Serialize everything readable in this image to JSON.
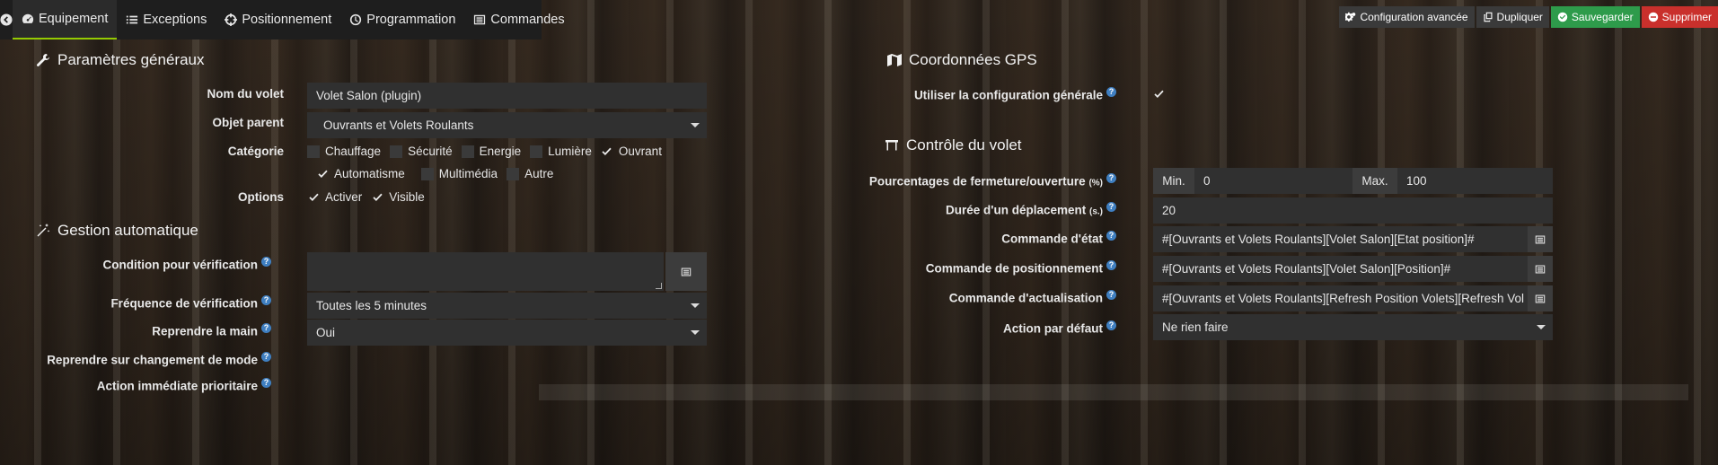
{
  "tabs": {
    "equipement": "Equipement",
    "exceptions": "Exceptions",
    "positionnement": "Positionnement",
    "programmation": "Programmation",
    "commandes": "Commandes"
  },
  "actions": {
    "config": "Configuration avancée",
    "duplicate": "Dupliquer",
    "save": "Sauvegarder",
    "delete": "Supprimer"
  },
  "general": {
    "title": "Paramètres généraux",
    "name_label": "Nom du volet",
    "name_value": "Volet Salon (plugin)",
    "parent_label": "Objet parent",
    "parent_value": "Ouvrants et Volets Roulants",
    "category_label": "Catégorie",
    "categories": [
      {
        "label": "Chauffage",
        "checked": false
      },
      {
        "label": "Sécurité",
        "checked": false
      },
      {
        "label": "Energie",
        "checked": false
      },
      {
        "label": "Lumière",
        "checked": false
      },
      {
        "label": "Ouvrant",
        "checked": true
      },
      {
        "label": "Automatisme",
        "checked": true
      },
      {
        "label": "Multimédia",
        "checked": false
      },
      {
        "label": "Autre",
        "checked": false
      }
    ],
    "options_label": "Options",
    "options": [
      {
        "label": "Activer",
        "checked": true
      },
      {
        "label": "Visible",
        "checked": true
      }
    ]
  },
  "auto": {
    "title": "Gestion automatique",
    "condition_label": "Condition pour vérification",
    "frequency_label": "Fréquence de vérification",
    "frequency_value": "Toutes les 5 minutes",
    "takeover_label": "Reprendre la main",
    "takeover_value": "Oui",
    "mode_change_label": "Reprendre sur changement de mode",
    "priority_label": "Action immédiate prioritaire"
  },
  "gps": {
    "title": "Coordonnées GPS",
    "use_general_label": "Utiliser la configuration générale",
    "use_general_checked": true
  },
  "control": {
    "title": "Contrôle du volet",
    "percent_label": "Pourcentages de fermeture/ouverture",
    "percent_unit": "(%)",
    "min_label": "Min.",
    "min_value": "0",
    "max_label": "Max.",
    "max_value": "100",
    "duration_label": "Durée d'un déplacement",
    "duration_unit": "(s.)",
    "duration_value": "20",
    "state_cmd_label": "Commande d'état",
    "state_cmd_value": "#[Ouvrants et Volets Roulants][Volet Salon][Etat position]#",
    "position_cmd_label": "Commande de positionnement",
    "position_cmd_value": "#[Ouvrants et Volets Roulants][Volet Salon][Position]#",
    "refresh_cmd_label": "Commande d'actualisation",
    "refresh_cmd_value": "#[Ouvrants et Volets Roulants][Refresh Position Volets][Refresh Vol",
    "default_action_label": "Action par défaut",
    "default_action_value": "Ne rien faire"
  },
  "help_glyph": "?",
  "colors": {
    "accent": "#94ca02",
    "save": "#2e9b4b",
    "delete": "#c9302c",
    "help": "#3f7fc1"
  }
}
